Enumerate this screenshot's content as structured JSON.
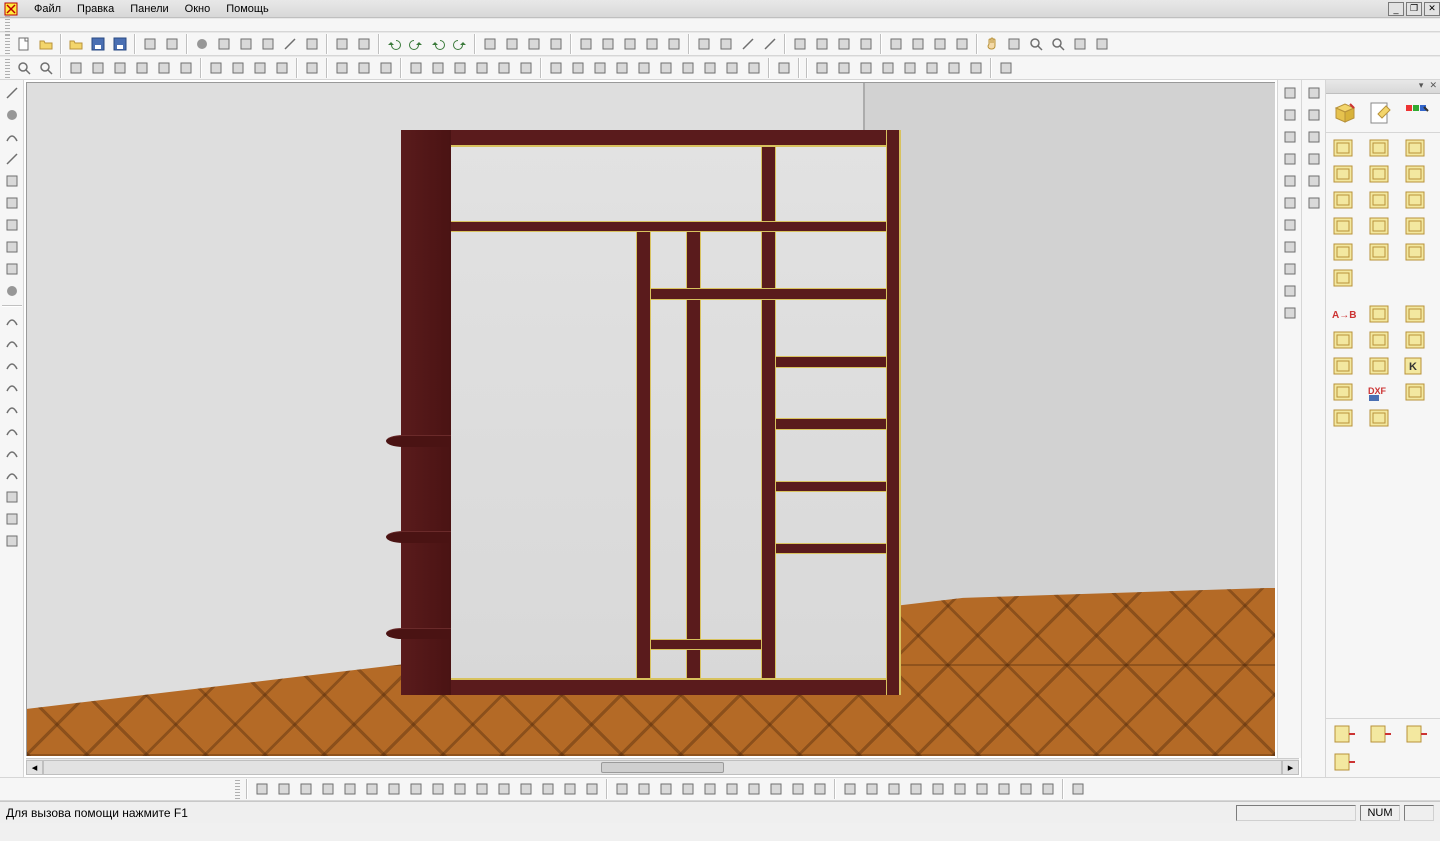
{
  "app": {
    "icon": "app-icon"
  },
  "menu": {
    "file": "Файл",
    "edit": "Правка",
    "panels": "Панели",
    "window": "Окно",
    "help": "Помощь"
  },
  "window_controls": {
    "min": "_",
    "restore": "❐",
    "close": "✕"
  },
  "status": {
    "hint": "Для вызова помощи нажмите F1",
    "num": "NUM"
  },
  "toolbar1": [
    "new-doc",
    "open-doc",
    "sep",
    "open-folder",
    "save",
    "save-all",
    "sep",
    "copy-doc",
    "paste-doc",
    "sep",
    "pointer",
    "tool-a",
    "tool-b",
    "tool-c",
    "line",
    "pen",
    "sep",
    "copy",
    "duplicate",
    "sep",
    "undo",
    "redo",
    "undo-list",
    "redo-list",
    "sep",
    "navigate",
    "nav-a",
    "nav-b",
    "nav-c",
    "sep",
    "grid-h",
    "grid-v",
    "grid-d",
    "grid-r",
    "grid-x",
    "sep",
    "cut-a",
    "cut-b",
    "line-h",
    "line-v",
    "sep",
    "door-a",
    "door-b",
    "door-c",
    "door-d",
    "sep",
    "constraint-a",
    "constraint-b",
    "constraint-c",
    "constraint-d",
    "sep",
    "hand",
    "fit",
    "zoom-a",
    "zoom-b",
    "rotate",
    "action"
  ],
  "toolbar2": [
    "zoom",
    "zoom-out",
    "sep",
    "sel-a",
    "sel-b",
    "sel-c",
    "sel-d",
    "sel-e",
    "sel-f",
    "sep",
    "prim-a",
    "prim-b",
    "prim-c",
    "prim-d",
    "sep",
    "pencil",
    "sep",
    "layer-a",
    "layer-b",
    "layer-c",
    "sep",
    "panel-1",
    "panel-2",
    "panel-3",
    "panel-4",
    "panel-5",
    "panel-6",
    "sep",
    "snap-1",
    "snap-2",
    "snap-3",
    "snap-4",
    "snap-5",
    "snap-6",
    "snap-7",
    "snap-8",
    "snap-9",
    "snap-grid",
    "sep",
    "props",
    "sep",
    "sep",
    "align-1",
    "align-2",
    "align-3",
    "align-4",
    "align-5",
    "align-6",
    "align-7",
    "align-8",
    "sep",
    "wave"
  ],
  "left_tools_a": [
    "line",
    "circle",
    "arc",
    "spline",
    "rect",
    "text",
    "hatch",
    "rect-2",
    "polygon",
    "point"
  ],
  "left_tools_b": [
    "curve-a",
    "curve-b",
    "curve-c",
    "curve-d",
    "curve-e",
    "curve-f",
    "curve-g",
    "curve-h",
    "mirror",
    "trim",
    "tangent"
  ],
  "right_tools": [
    "bracket",
    "lock",
    "arrow",
    "select",
    "x-tool",
    "panel",
    "edge",
    "plus-tool",
    "table",
    "divider",
    "props"
  ],
  "right_scroll_strip": [
    "arrow",
    "lock",
    "dim",
    "dim-angle",
    "arrow-b",
    "link"
  ],
  "panel_top": [
    "package",
    "edit",
    "colors"
  ],
  "panel_grid": [
    "panel-plain",
    "panel-border",
    "panel-l",
    "panel-r",
    "panel-curve-l",
    "panel-curve-r",
    "panel-hammer",
    "panel-small",
    "panel-stack",
    "panel-batch",
    "panel-label",
    "panel-list",
    "panel-img",
    "panel-table",
    "panel-grid",
    "panel-sum",
    "sep-row",
    "panel-a-b",
    "panel-curve-s",
    "panel-wood",
    "panel-arrow",
    "panel-cube",
    "panel-x",
    "panel-burst",
    "panel-light",
    "panel-k",
    "panel-spark",
    "panel-dxf",
    "panel-copy",
    "panel-books",
    "panel-book"
  ],
  "panel_bottom": [
    "panel-door-l",
    "panel-door-r",
    "panel-door-b",
    "panel-door-bb"
  ],
  "bottom_toolbar": [
    "sep",
    "shape-1",
    "shape-2",
    "shape-3",
    "shape-4",
    "shape-5",
    "shape-6",
    "shape-7",
    "shape-8",
    "shape-9",
    "shape-10",
    "shape-11",
    "shape-12",
    "shape-13",
    "shape-14",
    "shape-15",
    "shape-16",
    "sep",
    "edge-1",
    "edge-2",
    "edge-3",
    "edge-4",
    "edge-5",
    "edge-6",
    "edge-7",
    "edge-8",
    "edge-9",
    "edge-10",
    "sep",
    "obj-1",
    "obj-2",
    "obj-3",
    "obj-4",
    "obj-5",
    "obj-6",
    "obj-7",
    "obj-8",
    "obj-9",
    "obj-10",
    "sep",
    "check"
  ],
  "colors": {
    "toolbar_icon": "#7a7a7a",
    "primary": "#5a1b1c",
    "edge": "#d8c25e"
  },
  "labels": {
    "dxf": "DXF",
    "ab": "A→B",
    "k": "K"
  }
}
